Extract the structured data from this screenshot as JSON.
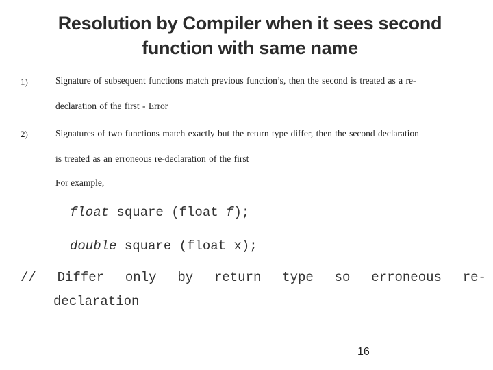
{
  "slide": {
    "title_lines": [
      "Resolution by Compiler when it sees second",
      "function with same name"
    ],
    "items": [
      {
        "number": "1)",
        "lines": [
          "Signature of subsequent functions match previous function’s, then the second is treated as a re-",
          "declaration of the first - Error"
        ]
      },
      {
        "number": "2)",
        "lines": [
          "Signatures of two functions match exactly but  the return type differ, then the second declaration",
          "is treated as an erroneous re-declaration of the first"
        ]
      }
    ],
    "example_label": "For example,",
    "code": {
      "line1": {
        "return_type": "float",
        "rest_before_param": " square (float ",
        "param": "f",
        "end": ");"
      },
      "line2": {
        "return_type": "double",
        "rest": " square (float x);"
      }
    },
    "comment": {
      "words": [
        "//",
        "Differ",
        "only",
        "by",
        "return",
        "type",
        "so",
        "erroneous",
        "re-"
      ],
      "line2": "declaration"
    },
    "page_number": "16"
  }
}
